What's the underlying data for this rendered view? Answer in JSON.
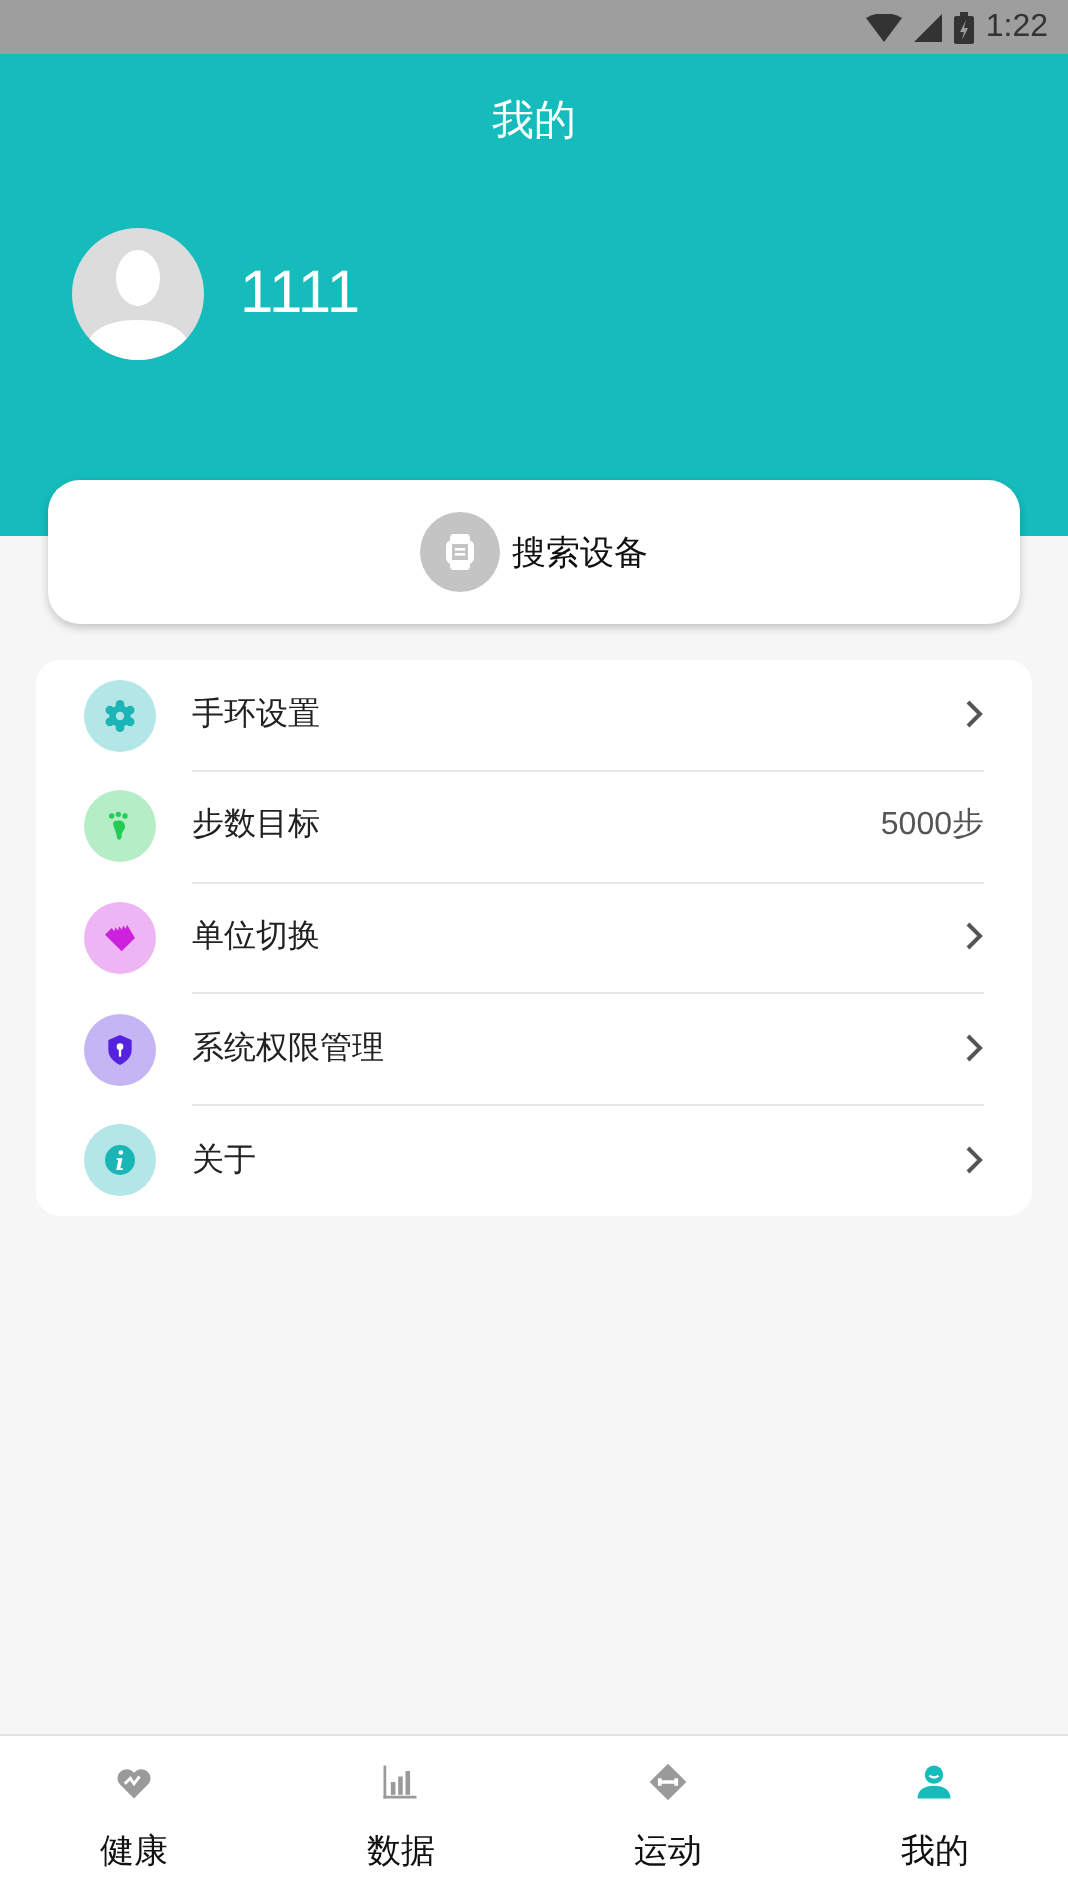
{
  "status_bar": {
    "time": "1:22"
  },
  "header": {
    "title": "我的"
  },
  "profile": {
    "name": "1111"
  },
  "search_device": {
    "label": "搜索设备"
  },
  "menu": [
    {
      "label": "手环设置",
      "kind": "chevron",
      "color": "#1bb5b5"
    },
    {
      "label": "步数目标",
      "kind": "value",
      "value": "5000步",
      "color": "#22cc55"
    },
    {
      "label": "单位切换",
      "kind": "chevron",
      "color": "#cc22dd"
    },
    {
      "label": "系统权限管理",
      "kind": "chevron",
      "color": "#5522dd"
    },
    {
      "label": "关于",
      "kind": "chevron",
      "color": "#1bb5b5"
    }
  ],
  "tabs": [
    {
      "label": "健康",
      "selected": false
    },
    {
      "label": "数据",
      "selected": false
    },
    {
      "label": "运动",
      "selected": false
    },
    {
      "label": "我的",
      "selected": true
    }
  ]
}
